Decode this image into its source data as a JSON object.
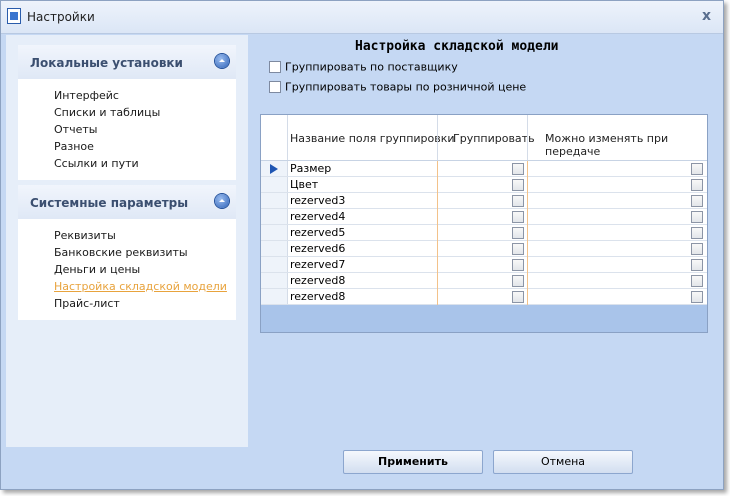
{
  "window": {
    "title": "Настройки",
    "close_symbol": "x"
  },
  "sidebar": {
    "local": {
      "title": "Локальные установки",
      "items": [
        "Интерфейс",
        "Списки и таблицы",
        "Отчеты",
        "Разное",
        "Ссылки и пути"
      ]
    },
    "system": {
      "title": "Системные параметры",
      "items": [
        "Реквизиты",
        "Банковские реквизиты",
        "Деньги и цены",
        "Настройка складской модели",
        "Прайс-лист"
      ],
      "active_index": 3
    }
  },
  "main": {
    "title": "Настройка складской модели",
    "options": {
      "group_supplier": "Группировать по поставщику",
      "group_retail": "Группировать товары по розничной цене"
    },
    "grid": {
      "columns": [
        "Название поля группировки",
        "Группировать",
        "Можно изменять при передаче"
      ],
      "rows": [
        "Размер",
        "Цвет",
        "rezerved3",
        "rezerved4",
        "rezerved5",
        "rezerved6",
        "rezerved7",
        "rezerved8",
        "rezerved8"
      ],
      "current_row": 0
    },
    "buttons": {
      "apply": "Применить",
      "cancel": "Отмена"
    }
  },
  "colors": {
    "accent": "#1e55b3",
    "active_link": "#e8a33d",
    "background": "#c5d8f3"
  }
}
